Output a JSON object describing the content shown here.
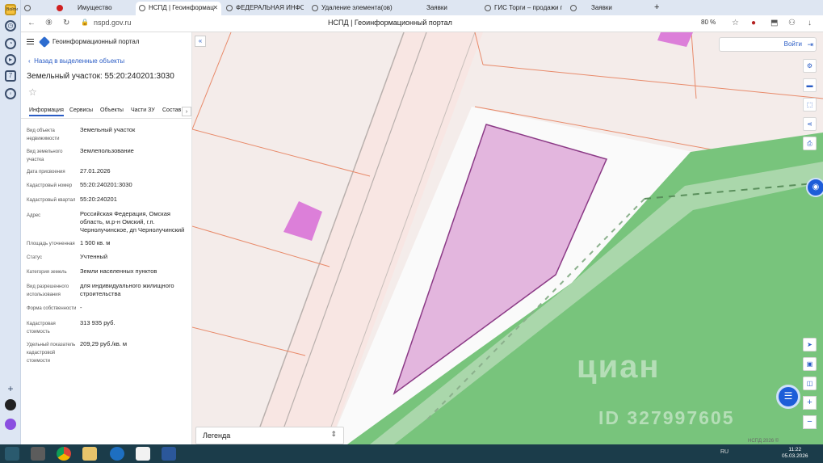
{
  "browser": {
    "tabs": [
      {
        "label": "Имущество"
      },
      {
        "label": "НСПД | Геоинформац"
      },
      {
        "label": "ФЕДЕРАЛЬНАЯ ИНФОРМ"
      },
      {
        "label": "Удаление элемента(ов) и"
      },
      {
        "label": "Заявки"
      },
      {
        "label": "ГИС Торги – продажи гос"
      },
      {
        "label": "Заявки"
      }
    ],
    "url": "nspd.gov.ru",
    "page_title": "НСПД | Геоинформационный портал",
    "zoom": "80 %",
    "vpn_badge": "Войти"
  },
  "sidebar": {
    "brand": "Геоинформационный портал",
    "back_link": "Назад в выделенные объекты",
    "object_title": "Земельный участок: 55:20:240201:3030",
    "tabs": [
      "Информация",
      "Сервисы",
      "Объекты",
      "Части ЗУ",
      "Состав"
    ],
    "properties": [
      {
        "label": "Вид объекта недвижимости",
        "value": "Земельный участок"
      },
      {
        "label": "Вид земельного участка",
        "value": "Землепользование"
      },
      {
        "label": "Дата присвоения",
        "value": "27.01.2026"
      },
      {
        "label": "Кадастровый номер",
        "value": "55:20:240201:3030"
      },
      {
        "label": "Кадастровый квартал",
        "value": "55:20:240201"
      },
      {
        "label": "Адрес",
        "value": "Российская Федерация, Омская область, м.р-н Омский, г.п. Чернолучинское, дп Чернолучинский"
      },
      {
        "label": "Площадь уточненная",
        "value": "1 500 кв. м"
      },
      {
        "label": "Статус",
        "value": "Учтенный"
      },
      {
        "label": "Категория земель",
        "value": "Земли населенных пунктов"
      },
      {
        "label": "Вид разрешенного использования",
        "value": "для индивидуального жилищного строительства"
      },
      {
        "label": "Форма собственности",
        "value": "-"
      },
      {
        "label": "Кадастровая стоимость",
        "value": "313 935 руб."
      },
      {
        "label": "Удельный показатель кадастровой стоимости",
        "value": "209,29 руб./кв. м"
      }
    ]
  },
  "map": {
    "login_label": "Войти",
    "legend_label": "Легенда",
    "watermark": "циан",
    "watermark_id": "ID 327997605",
    "attribution": "НСПД 2026 ©",
    "colors": {
      "parcel": "#e3b6de",
      "parcel_border": "#8b3a86",
      "forest": "#76c27a",
      "small_parcel": "#dc7fd9"
    }
  },
  "taskbar": {
    "tray_lang": "RU",
    "time": "11:22",
    "date": "05.03.2026"
  }
}
